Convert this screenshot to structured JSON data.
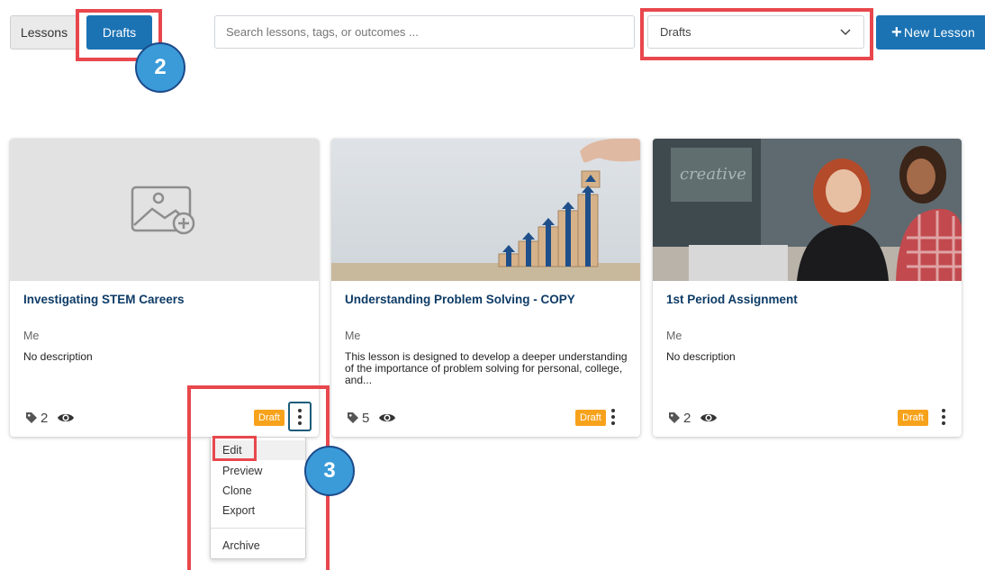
{
  "toolbar": {
    "tab_lessons": "Lessons",
    "tab_drafts": "Drafts",
    "search_placeholder": "Search lessons, tags, or outcomes ...",
    "filter_value": "Drafts",
    "new_lesson_label": "New Lesson"
  },
  "annotations": {
    "step_2": "2",
    "step_3": "3",
    "highlight_color": "#e8474d",
    "badge_color": "#3a9bd8"
  },
  "cards": [
    {
      "title": "Investigating STEM Careers",
      "author": "Me",
      "description": "No description",
      "tag_count": "2",
      "status": "Draft",
      "thumbnail": "image-placeholder-icon"
    },
    {
      "title": "Understanding Problem Solving - COPY",
      "author": "Me",
      "description": "This lesson is designed to develop a deeper understanding of the importance of problem solving for personal, college, and...",
      "tag_count": "5",
      "status": "Draft",
      "thumbnail": "wooden-blocks-stairs-photo"
    },
    {
      "title": "1st Period Assignment",
      "author": "Me",
      "description": "No description",
      "tag_count": "2",
      "status": "Draft",
      "thumbnail": "women-at-laptop-photo"
    }
  ],
  "context_menu": {
    "items": [
      "Edit",
      "Preview",
      "Clone",
      "Export"
    ],
    "archive": "Archive"
  },
  "colors": {
    "primary": "#1b73b4",
    "title_text": "#0d3b66",
    "draft_badge": "#f7a21b"
  }
}
